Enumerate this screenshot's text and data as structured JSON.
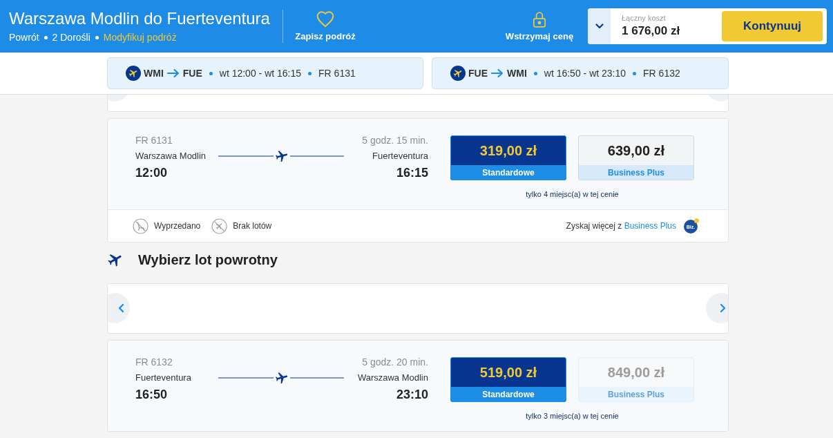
{
  "header": {
    "title": "Warszawa Modlin do Fuerteventura",
    "trip_type": "Powrót",
    "passengers": "2 Dorośli",
    "modify_link": "Modyfikuj podróż",
    "actions": [
      {
        "kind": "save",
        "label": "Zapisz podróż"
      },
      {
        "kind": "hold",
        "label": "Wstrzymaj cenę"
      }
    ],
    "total": {
      "label": "Łączny koszt",
      "amount": "1 676,00 zł"
    },
    "continue_button": "Kontynuuj"
  },
  "summary": [
    {
      "from": "WMI",
      "to": "FUE",
      "times": "wt 12:00 - wt 16:15",
      "flight": "FR 6131"
    },
    {
      "from": "FUE",
      "to": "WMI",
      "times": "wt 16:50 - wt 23:10",
      "flight": "FR 6132"
    }
  ],
  "outbound": {
    "flight": {
      "number": "FR 6131",
      "duration": "5 godz. 15 min.",
      "origin": "Warszawa Modlin",
      "departure": "12:00",
      "destination": "Fuerteventura",
      "arrival": "16:15",
      "fares": [
        {
          "price": "319,00 zł",
          "label": "Standardowe",
          "selected": true,
          "disabled": false
        },
        {
          "price": "639,00 zł",
          "label": "Business Plus",
          "selected": false,
          "disabled": false
        }
      ],
      "seats_note": "tylko 4 miejsc(a) w tej cenie"
    },
    "legend": [
      {
        "kind": "sold_out",
        "label": "Wyprzedano"
      },
      {
        "kind": "no_flights",
        "label": "Brak lotów"
      }
    ],
    "upsell": {
      "text": "Zyskaj więcej z",
      "link": "Business Plus",
      "badge": "Biz."
    }
  },
  "return_section": {
    "title": "Wybierz lot powrotny",
    "flight": {
      "number": "FR 6132",
      "duration": "5 godz. 20 min.",
      "origin": "Fuerteventura",
      "departure": "16:50",
      "destination": "Warszawa Modlin",
      "arrival": "23:10",
      "fares": [
        {
          "price": "519,00 zł",
          "label": "Standardowe",
          "selected": true,
          "disabled": false
        },
        {
          "price": "849,00 zł",
          "label": "Business Plus",
          "selected": false,
          "disabled": true
        }
      ],
      "seats_note": "tylko 3 miejsc(a) w tej cenie"
    }
  }
}
